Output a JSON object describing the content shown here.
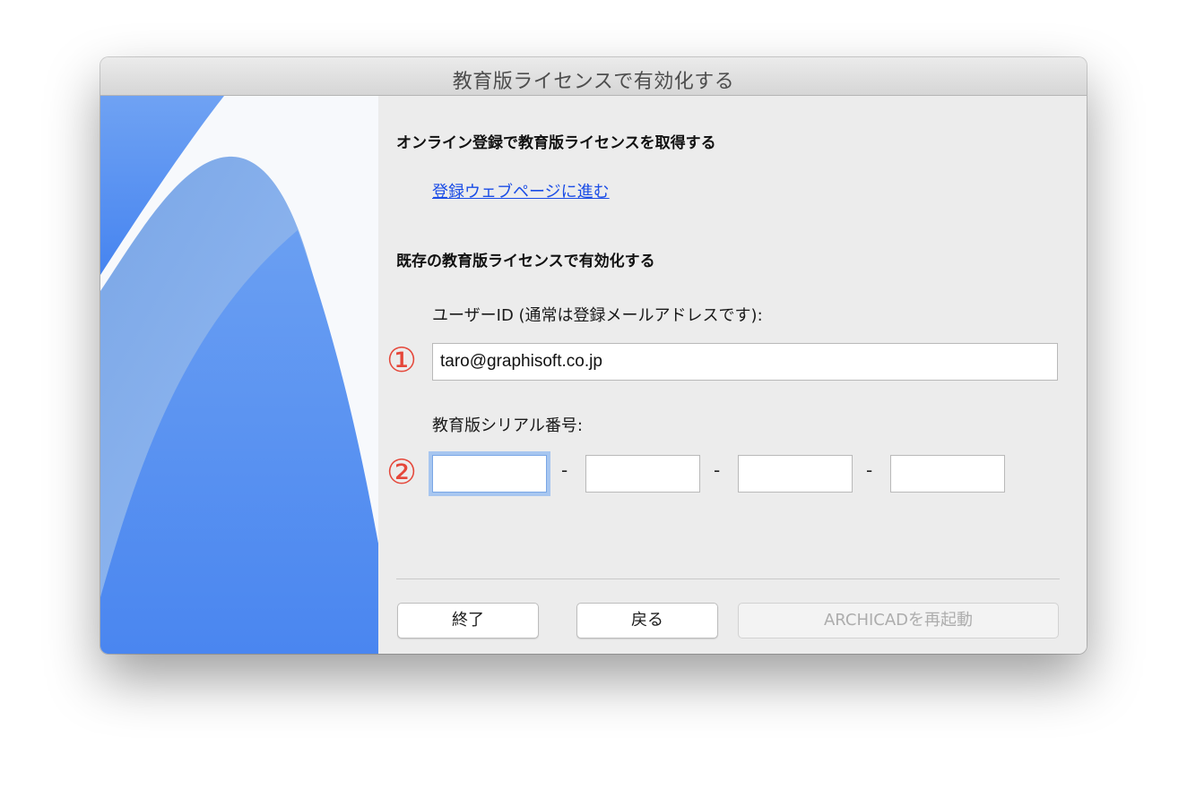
{
  "window": {
    "title": "教育版ライセンスで有効化する"
  },
  "online": {
    "heading": "オンライン登録で教育版ライセンスを取得する",
    "link_label": "登録ウェブページに進む"
  },
  "existing": {
    "heading": "既存の教育版ライセンスで有効化する",
    "user_id_label": "ユーザーID (通常は登録メールアドレスです):",
    "user_id_value": "taro@graphisoft.co.jp",
    "serial_label": "教育版シリアル番号:",
    "serial_fields": [
      "",
      "",
      "",
      ""
    ],
    "serial_separator": "-"
  },
  "annotations": {
    "marker_1": "①",
    "marker_2": "②",
    "color": "#e5473a"
  },
  "buttons": {
    "quit": "終了",
    "back": "戻る",
    "restart": "ARCHICADを再起動",
    "restart_enabled": false
  },
  "colors": {
    "link": "#1a4ce6",
    "focus_ring": "#a7c6f0",
    "side_blue": "#5b93f2"
  }
}
